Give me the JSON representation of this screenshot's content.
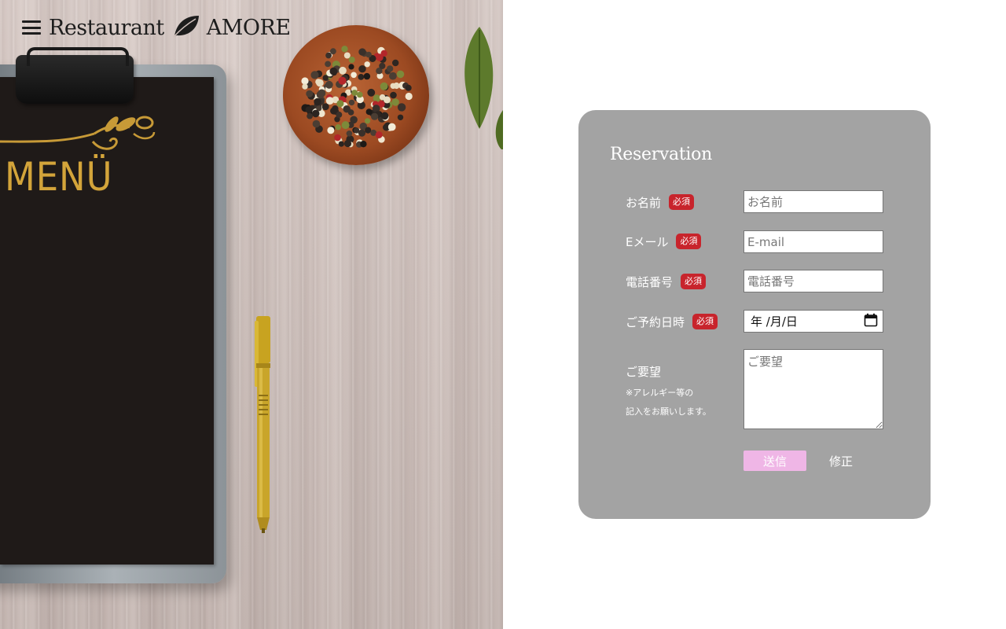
{
  "header": {
    "brand_left": "Restaurant",
    "brand_right": "AMORE"
  },
  "hero": {
    "menu_title": "MENÜ"
  },
  "form": {
    "title": "Reservation",
    "required_badge": "必須",
    "fields": [
      {
        "label": "お名前",
        "placeholder": "お名前",
        "required": true
      },
      {
        "label": "Eメール",
        "placeholder": "E-mail",
        "required": true
      },
      {
        "label": "電話番号",
        "placeholder": "電話番号",
        "required": true
      },
      {
        "label": "ご予約日時",
        "value": "年 /月/日",
        "required": true
      }
    ],
    "requests": {
      "label": "ご要望",
      "note_line1": "※アレルギー等の",
      "note_line2": "記入をお願いします。",
      "placeholder": "ご要望"
    },
    "submit_label": "送信",
    "reset_label": "修正"
  },
  "colors": {
    "card_bg": "#a3a3a3",
    "badge": "#c8242c",
    "submit_bg": "#efb6e6",
    "menu_gold": "#d3a43a"
  }
}
